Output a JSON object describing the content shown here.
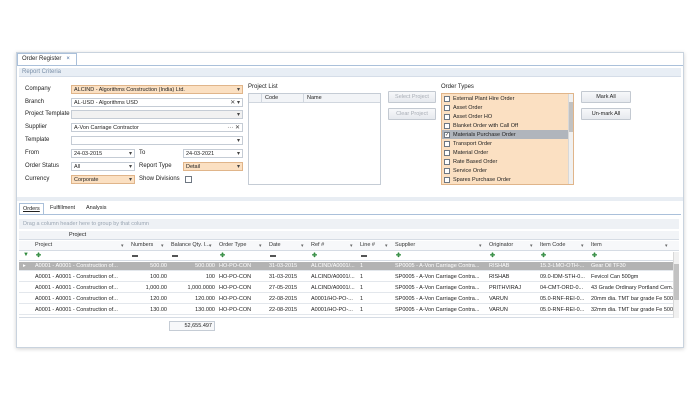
{
  "tab": {
    "title": "Order Register",
    "close": "×"
  },
  "criteria": {
    "header": "Report Criteria",
    "company": {
      "label": "Company",
      "value": "ALCIND - Algorithms Construction (India) Ltd."
    },
    "branch": {
      "label": "Branch",
      "value": "AL-USD - Algorithms USD"
    },
    "project_template": {
      "label": "Project Template",
      "value": ""
    },
    "supplier": {
      "label": "Supplier",
      "value": "A-Von Carriage Contractor"
    },
    "template": {
      "label": "Template",
      "value": ""
    },
    "from": {
      "label": "From",
      "value": "24-03-2015"
    },
    "to": {
      "label": "To",
      "value": "24-03-2021"
    },
    "order_status": {
      "label": "Order Status",
      "value": "All"
    },
    "report_type": {
      "label": "Report Type",
      "value": "Detail"
    },
    "currency": {
      "label": "Currency",
      "value": "Corporate"
    },
    "show_divisions": {
      "label": "Show Divisions"
    }
  },
  "project_list": {
    "title": "Project List",
    "col_code": "Code",
    "col_name": "Name",
    "select_btn": "Select Project",
    "clear_btn": "Clear Project"
  },
  "order_types": {
    "title": "Order Types",
    "items": [
      {
        "label": "External Plant Hire Order",
        "checked": false
      },
      {
        "label": "Asset Order",
        "checked": false
      },
      {
        "label": "Asset Order HO",
        "checked": false
      },
      {
        "label": "Blanket Order with Call Off",
        "checked": false
      },
      {
        "label": "Materials Purchase Order",
        "checked": true
      },
      {
        "label": "Transport Order",
        "checked": false
      },
      {
        "label": "Material Order",
        "checked": false
      },
      {
        "label": "Rate Based Order",
        "checked": false
      },
      {
        "label": "Service Order",
        "checked": false
      },
      {
        "label": "Spares Purchase Order",
        "checked": false
      }
    ],
    "mark_all": "Mark All",
    "unmark_all": "Un-mark All"
  },
  "bottom_tabs": [
    "Orders",
    "Fulfillment",
    "Analysis"
  ],
  "group_hint": "Drag a column header here to group by that column",
  "grid": {
    "band": "Project",
    "columns": [
      "Project",
      "Numbers",
      "Balance Qty. I...",
      "Order Type",
      "Date",
      "Ref #",
      "Line #",
      "Supplier",
      "Originator",
      "Item Code",
      "Item"
    ],
    "rows": [
      [
        "A0001 - A0001 - Construction of...",
        "500.00",
        "500.000",
        "HO-PO-CON",
        "31-03-2015",
        "ALCIND/A0001/...",
        "1",
        "SP0005 - A-Von Carriage Contra...",
        "RISHAB",
        "15.3-LMO-OTH-...",
        "Gear Oil TF30"
      ],
      [
        "A0001 - A0001 - Construction of...",
        "100.00",
        "100",
        "HO-PO-CON",
        "31-03-2015",
        "ALCIND/A0001/...",
        "1",
        "SP0005 - A-Von Carriage Contra...",
        "RISHAB",
        "09.0-IDM-STH-0...",
        "Fevicol Can 500gm"
      ],
      [
        "A0001 - A0001 - Construction of...",
        "1,000.00",
        "1,000.0000",
        "HO-PO-CON",
        "27-05-2015",
        "ALCIND/A0001/...",
        "1",
        "SP0005 - A-Von Carriage Contra...",
        "PRITHVIRAJ",
        "04-CMT-ORD-0...",
        "43 Grade Ordinary Portland Cem..."
      ],
      [
        "A0001 - A0001 - Construction of...",
        "120.00",
        "120.000",
        "HO-PO-CON",
        "22-08-2015",
        "A0001/HO-PO-...",
        "1",
        "SP0005 - A-Von Carriage Contra...",
        "VARUN",
        "05.0-RNF-REI-0...",
        "20mm dia. TMT bar grade Fe 500"
      ],
      [
        "A0001 - A0001 - Construction of...",
        "130.00",
        "130.000",
        "HO-PO-CON",
        "22-08-2015",
        "A0001/HO-PO-...",
        "1",
        "SP0005 - A-Von Carriage Contra...",
        "VARUN",
        "05.0-RNF-REI-0...",
        "32mm dia. TMT bar grade Fe 500"
      ]
    ],
    "footer_total": "52,655.497"
  }
}
